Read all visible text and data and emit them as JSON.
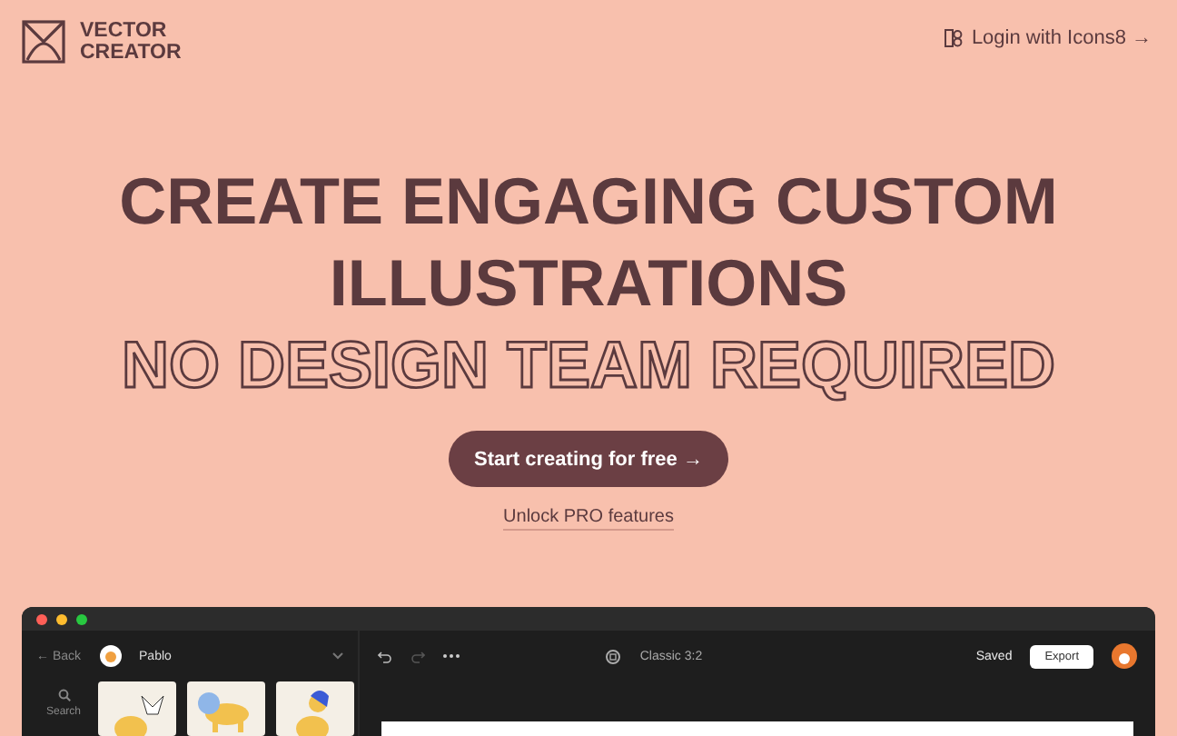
{
  "header": {
    "logo": "VECTOR CREATOR",
    "login": "Login with Icons8 →"
  },
  "headline": {
    "lines": [
      "CREATE ENGAGING CUSTOM",
      "ILLUSTRATIONS"
    ],
    "outlined": "NO DESIGN TEAM REQUIRED"
  },
  "cta": {
    "button": "Start creating for free →",
    "link": "Unlock PRO features"
  },
  "app": {
    "back": "← Back",
    "character": "Pablo",
    "search": "Search",
    "format": "Classic 3:2",
    "status": "Saved",
    "export": "Export"
  }
}
